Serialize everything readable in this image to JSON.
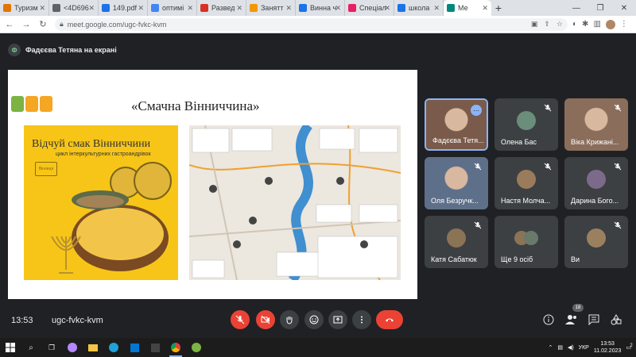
{
  "browser": {
    "tabs": [
      {
        "label": "Туризм",
        "color": "#e37400"
      },
      {
        "label": "<4D696",
        "color": "#5f6368"
      },
      {
        "label": "149.pdf",
        "color": "#1a73e8"
      },
      {
        "label": "оптимі",
        "color": "#4285f4"
      },
      {
        "label": "Развед",
        "color": "#d93025"
      },
      {
        "label": "Занятт",
        "color": "#f29900"
      },
      {
        "label": "Винна ч",
        "color": "#1a73e8"
      },
      {
        "label": "Спеціал",
        "color": "#e91e63"
      },
      {
        "label": "школа",
        "color": "#1a73e8"
      },
      {
        "label": "Ме",
        "color": "#00897b"
      }
    ],
    "url": "meet.google.com/ugc-fvkc-kvm"
  },
  "meet": {
    "presenter_label": "Фадєєва Тетяна на екрані",
    "presenter_initial": "Ф",
    "time": "13:53",
    "code": "ugc-fvkc-kvm",
    "participant_count": "18",
    "participants": [
      {
        "name": "Фадєєва Тетя...",
        "kind": "video",
        "speaking": true
      },
      {
        "name": "Олена Бас",
        "kind": "avatar"
      },
      {
        "name": "Віка Крижані...",
        "kind": "video"
      },
      {
        "name": "Оля Безручк...",
        "kind": "video"
      },
      {
        "name": "Настя Молча...",
        "kind": "avatar"
      },
      {
        "name": "Дарина Бого...",
        "kind": "avatar"
      },
      {
        "name": "Катя Сабатюк",
        "kind": "avatar"
      },
      {
        "name": "Ще 9 осіб",
        "kind": "group"
      },
      {
        "name": "Ви",
        "kind": "avatar"
      }
    ]
  },
  "slide": {
    "title": "«Смачна Вінниччина»",
    "poster_title": "Відчуй смак Вінниччини",
    "poster_subtitle": "цикл інтеркультурних гастроандрівок",
    "poster_logo": "Вінниця"
  },
  "taskbar": {
    "lang": "УКР",
    "time": "13:53",
    "date": "11.02.2023",
    "notif": "2"
  }
}
